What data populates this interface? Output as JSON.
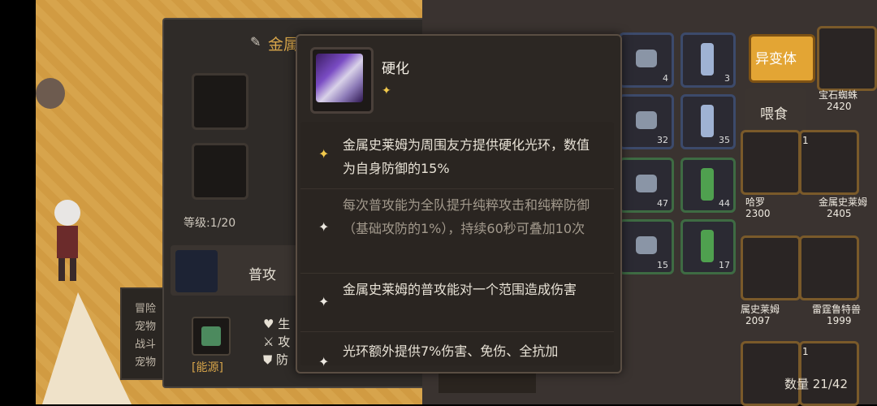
{
  "pet_panel": {
    "name": "金属",
    "level": "等级:1/20",
    "attack": {
      "label": "普攻"
    },
    "energy": {
      "label": "[能源]"
    },
    "stats": [
      "生",
      "攻",
      "防"
    ],
    "info_lines": [
      "冒险",
      "宠物",
      "战斗",
      "宠物"
    ]
  },
  "inventory": {
    "items": [
      {
        "count": "4"
      },
      {
        "count": "3"
      },
      {
        "count": "32"
      },
      {
        "count": "35"
      },
      {
        "count": "47"
      },
      {
        "count": "44"
      },
      {
        "count": "15"
      },
      {
        "count": "17"
      }
    ],
    "mutate_label": "异变体",
    "feed_label": "喂食",
    "pets": [
      {
        "name": "宝石蜘蛛",
        "value": "2420"
      },
      {
        "name": "哈罗",
        "value": "2300"
      },
      {
        "name": "金属史莱姆",
        "value": "2405"
      },
      {
        "name": "属史莱姆",
        "value": "2097"
      },
      {
        "name": "雷霆鲁特兽",
        "value": "1999"
      }
    ],
    "card_level": "1",
    "count_label": "数量 21/42"
  },
  "tooltip": {
    "title": "硬化",
    "star": "✦",
    "lines": [
      {
        "text": "金属史莱姆为周围友方提供硬化光环，数值为自身防御的15%",
        "active": true
      },
      {
        "text": "每次普攻能为全队提升纯粹攻击和纯粹防御（基础攻防的1%），持续60秒可叠加10次",
        "active": false
      },
      {
        "text": "金属史莱姆的普攻能对一个范围造成伤害",
        "active": true
      },
      {
        "text": "光环额外提供7%伤害、免伤、全抗加",
        "active": true
      }
    ]
  },
  "colors": {
    "accent": "#d7a54a",
    "panel": "#2f2b28",
    "mutate": "#e3a534"
  }
}
